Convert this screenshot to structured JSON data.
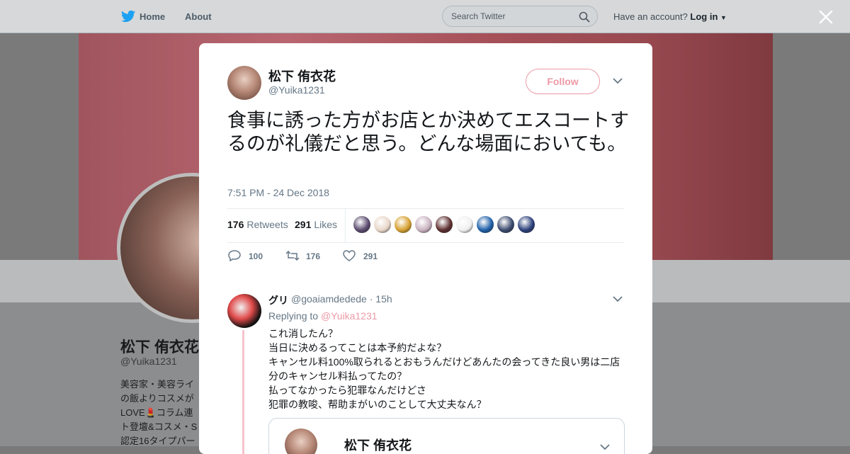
{
  "nav": {
    "home_label": "Home",
    "about_label": "About",
    "search_placeholder": "Search Twitter",
    "account_prompt": "Have an account?",
    "login_label": "Log in"
  },
  "profile_bg": {
    "name": "松下 侑衣花",
    "handle": "@Yuika1231",
    "bio_lines": [
      "美容家・美容ライ",
      "の飯よりコスメが",
      "LOVE💄コラム連",
      "ト登壇&コスメ・S",
      "認定16タイプパー"
    ]
  },
  "tweet": {
    "author_name": "松下 侑衣花",
    "author_handle": "@Yuika1231",
    "follow_label": "Follow",
    "text": "食事に誘った方がお店とか決めてエスコートするのが礼儀だと思う。どんな場面においても。",
    "timestamp": "7:51 PM - 24 Dec 2018",
    "retweets_count": "176",
    "retweets_label": "Retweets",
    "likes_count": "291",
    "likes_label": "Likes",
    "liker_colors": [
      "#5a4a6e",
      "#e8d6c8",
      "#d6a030",
      "#c9b2c0",
      "#5d2e2e",
      "#f0f0f0",
      "#1e5fa8",
      "#3b4a6e",
      "#2b3f7a"
    ],
    "actions": {
      "reply_count": "100",
      "retweet_count": "176",
      "like_count": "291"
    }
  },
  "reply": {
    "name": "グリ",
    "meta": "@goaiamdedede · 15h",
    "replying_prefix": "Replying to",
    "replying_to": "@Yuika1231",
    "lines": [
      "これ消したん？",
      "当日に決めるってことは本予約だよな？",
      "キャンセル料100%取られるとおもうんだけどあんたの会ってきた良い男は二店分のキャンセル料払ってたの？",
      "払ってなかったら犯罪なんだけどさ",
      "犯罪の教唆、帮助まがいのことして大丈夫なん？"
    ],
    "quote_name": "松下 侑衣花"
  }
}
